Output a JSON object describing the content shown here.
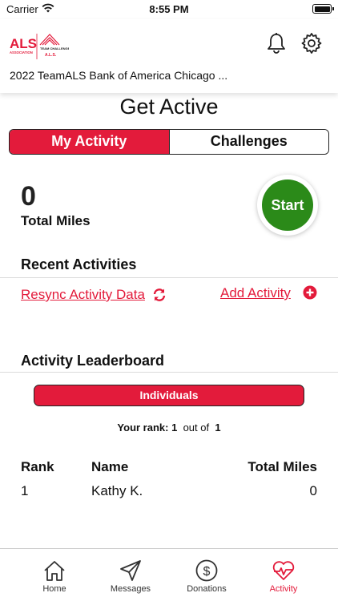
{
  "status_bar": {
    "carrier": "Carrier",
    "time": "8:55 PM"
  },
  "header": {
    "logo": {
      "name": "ALS Association Team Challenge logo",
      "text_primary": "ALS",
      "text_secondary": "ASSOCIATION",
      "team_text": "TEAM CHALLENGE",
      "team_sub": "A.L.S."
    },
    "event_title": "2022 TeamALS Bank of America Chicago ...",
    "icons": [
      "bell-icon",
      "gear-icon"
    ]
  },
  "page_title": "Get Active",
  "segments": {
    "active": "My Activity",
    "inactive": "Challenges"
  },
  "summary": {
    "miles_value": "0",
    "miles_label": "Total Miles",
    "start_label": "Start"
  },
  "recent": {
    "title": "Recent Activities",
    "resync_label": "Resync Activity Data",
    "add_label": "Add Activity"
  },
  "leaderboard": {
    "title": "Activity Leaderboard",
    "tab_label": "Individuals",
    "rank_prefix": "Your rank:",
    "rank_value": "1",
    "rank_mid": "out of",
    "rank_total": "1",
    "columns": {
      "rank": "Rank",
      "name": "Name",
      "miles": "Total Miles"
    },
    "rows": [
      {
        "rank": "1",
        "name": "Kathy K.",
        "miles": "0"
      }
    ]
  },
  "tabbar": {
    "items": [
      {
        "label": "Home",
        "icon": "home-icon"
      },
      {
        "label": "Messages",
        "icon": "paper-plane-icon"
      },
      {
        "label": "Donations",
        "icon": "dollar-circle-icon"
      },
      {
        "label": "Activity",
        "icon": "heart-pulse-icon"
      }
    ],
    "active": "Activity"
  },
  "colors": {
    "accent": "#e31b3b",
    "start_green": "#2b8a19",
    "text": "#111111"
  }
}
